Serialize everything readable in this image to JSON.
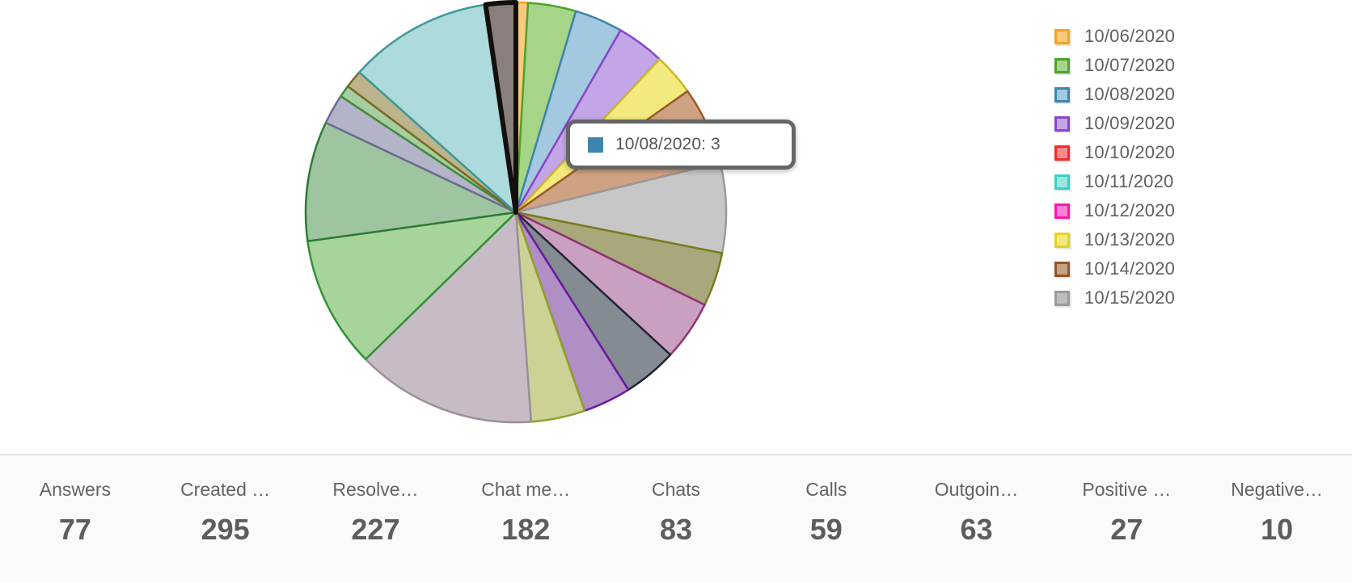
{
  "chart_data": {
    "type": "pie",
    "title": "",
    "center": [
      638,
      263
    ],
    "radius": 260,
    "start_angle_deg": -90,
    "legend_position": "right",
    "grid": false,
    "categories": [
      "10/06/2020",
      "10/07/2020",
      "10/08/2020",
      "10/09/2020",
      "10/10/2020",
      "10/11/2020",
      "10/12/2020",
      "10/13/2020",
      "10/14/2020",
      "10/15/2020"
    ],
    "legend_entries": [
      {
        "label": "10/06/2020",
        "fill": "#fcc97f",
        "stroke": "#f4a325"
      },
      {
        "label": "10/07/2020",
        "fill": "#a6d488",
        "stroke": "#4da32c"
      },
      {
        "label": "10/08/2020",
        "fill": "#a3c8e0",
        "stroke": "#3d85ad"
      },
      {
        "label": "10/09/2020",
        "fill": "#c3a6e8",
        "stroke": "#8a46c9"
      },
      {
        "label": "10/10/2020",
        "fill": "#f78b8b",
        "stroke": "#f02b2b"
      },
      {
        "label": "10/11/2020",
        "fill": "#9fe5df",
        "stroke": "#39cfc6"
      },
      {
        "label": "10/12/2020",
        "fill": "#fb7fd3",
        "stroke": "#f718ad"
      },
      {
        "label": "10/13/2020",
        "fill": "#f2ea7e",
        "stroke": "#e3d320"
      },
      {
        "label": "10/14/2020",
        "fill": "#c5a285",
        "stroke": "#92552a"
      },
      {
        "label": "10/15/2020",
        "fill": "#bdbdbd",
        "stroke": "#9a9a9a"
      }
    ],
    "slices": [
      {
        "label": "10/06/2020",
        "value": 2,
        "fill": "#fcc97f",
        "stroke": "#f4a325",
        "highlight": false
      },
      {
        "label": "10/07/2020",
        "value": 8,
        "fill": "#a6d488",
        "stroke": "#4da32c",
        "highlight": false
      },
      {
        "label": "10/08/2020",
        "value": 8,
        "fill": "#a3c8e0",
        "stroke": "#3d85ad",
        "highlight": false
      },
      {
        "label": "10/09/2020",
        "value": 8,
        "fill": "#c3a6e8",
        "stroke": "#8a46c9",
        "highlight": false
      },
      {
        "label": "10/13/2020",
        "value": 7,
        "fill": "#f2ea7e",
        "stroke": "#ccb72a",
        "highlight": false
      },
      {
        "label": "10/14/2020",
        "value": 13,
        "fill": "#cfa284",
        "stroke": "#9b5a24",
        "highlight": false
      },
      {
        "label": "10/15/2020",
        "value": 15,
        "fill": "#c7c7c7",
        "stroke": "#9a9a9a",
        "highlight": false
      },
      {
        "label": "10/15/2020",
        "value": 9,
        "fill": "#a8a87c",
        "stroke": "#7a7a1e",
        "highlight": false
      },
      {
        "label": "10/12/2020",
        "value": 10,
        "fill": "#c9a0bf",
        "stroke": "#8f3277",
        "highlight": false
      },
      {
        "label": "10/15/2020",
        "value": 9,
        "fill": "#858b93",
        "stroke": "#232336",
        "highlight": false
      },
      {
        "label": "10/09/2020",
        "value": 8,
        "fill": "#b08fc4",
        "stroke": "#6a1ba0",
        "highlight": false
      },
      {
        "label": "10/13/2020",
        "value": 9,
        "fill": "#cdd196",
        "stroke": "#8fa22b",
        "highlight": false
      },
      {
        "label": "10/15/2020",
        "value": 30,
        "fill": "#c7bcc6",
        "stroke": "#9a8e99",
        "highlight": false
      },
      {
        "label": "10/07/2020",
        "value": 22,
        "fill": "#a7d49b",
        "stroke": "#2f9134",
        "highlight": false
      },
      {
        "label": "10/07/2020",
        "value": 20,
        "fill": "#9ec5a0",
        "stroke": "#2f7a34",
        "highlight": false
      },
      {
        "label": "10/09/2020",
        "value": 5,
        "fill": "#b4b4c8",
        "stroke": "#6b6b90",
        "highlight": false
      },
      {
        "label": "10/07/2020",
        "value": 2,
        "fill": "#a8cda0",
        "stroke": "#3e8c3a",
        "highlight": false
      },
      {
        "label": "10/14/2020",
        "value": 3,
        "fill": "#bcb48b",
        "stroke": "#7a6a22",
        "highlight": false
      },
      {
        "label": "10/11/2020",
        "value": 24,
        "fill": "#addada",
        "stroke": "#3e999c",
        "highlight": false
      },
      {
        "label": "10/15/2020",
        "value": 5,
        "fill": "#897f7d",
        "stroke": "#120f0c",
        "highlight": true
      }
    ]
  },
  "tooltip": {
    "label": "10/08/2020: 3",
    "swatch_color": "#3d85ad"
  },
  "metrics": [
    {
      "label": "Answers",
      "value": "77"
    },
    {
      "label": "Created …",
      "value": "295"
    },
    {
      "label": "Resolve…",
      "value": "227"
    },
    {
      "label": "Chat me…",
      "value": "182"
    },
    {
      "label": "Chats",
      "value": "83"
    },
    {
      "label": "Calls",
      "value": "59"
    },
    {
      "label": "Outgoin…",
      "value": "63"
    },
    {
      "label": "Positive …",
      "value": "27"
    },
    {
      "label": "Negative…",
      "value": "10"
    }
  ]
}
